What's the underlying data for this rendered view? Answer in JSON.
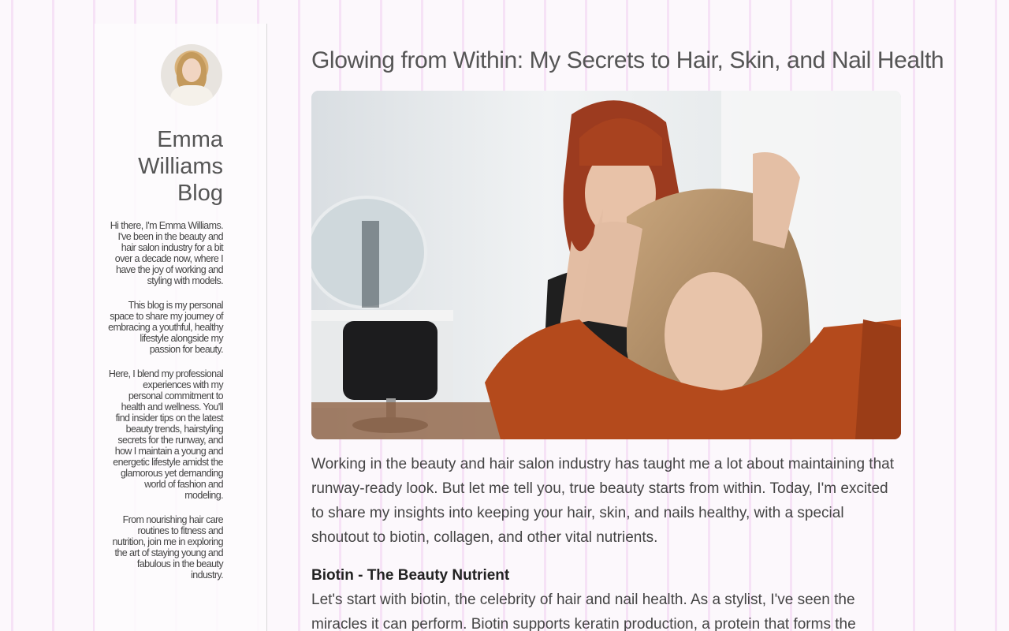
{
  "sidebar": {
    "avatar_icon": "profile-photo",
    "blog_name": "Emma Williams Blog",
    "intro_paragraphs": [
      "Hi there, I'm Emma Williams. I've been in the beauty and hair salon industry for a bit over a decade now, where I have the joy of working and styling with models.",
      "This blog is my personal space to share my journey of embracing a youthful, healthy lifestyle alongside my passion for beauty.",
      "Here, I blend my professional experiences with my personal commitment to health and wellness. You'll find insider tips on the latest beauty trends, hairstyling secrets for the runway, and how I maintain a young and energetic lifestyle amidst the glamorous yet demanding world of fashion and modeling.",
      "From nourishing hair care routines to fitness and nutrition, join me in exploring the art of staying young and fabulous in the beauty industry."
    ]
  },
  "post": {
    "title": "Glowing from Within: My Secrets to Hair, Skin, and Nail Health",
    "hero_image": "salon-stylist-and-client-photo",
    "intro": "Working in the beauty and hair salon industry has taught me a lot about maintaining that runway-ready look. But let me tell you, true beauty starts from within. Today, I'm excited to share my insights into keeping your hair, skin, and nails healthy, with a special shoutout to biotin, collagen, and other vital nutrients.",
    "section_heading": "Biotin - The Beauty Nutrient",
    "section_body": "Let's start with biotin, the celebrity of hair and nail health. As a stylist, I've seen the miracles it can perform. Biotin supports keratin production, a protein that forms the foundation of hair,"
  }
}
